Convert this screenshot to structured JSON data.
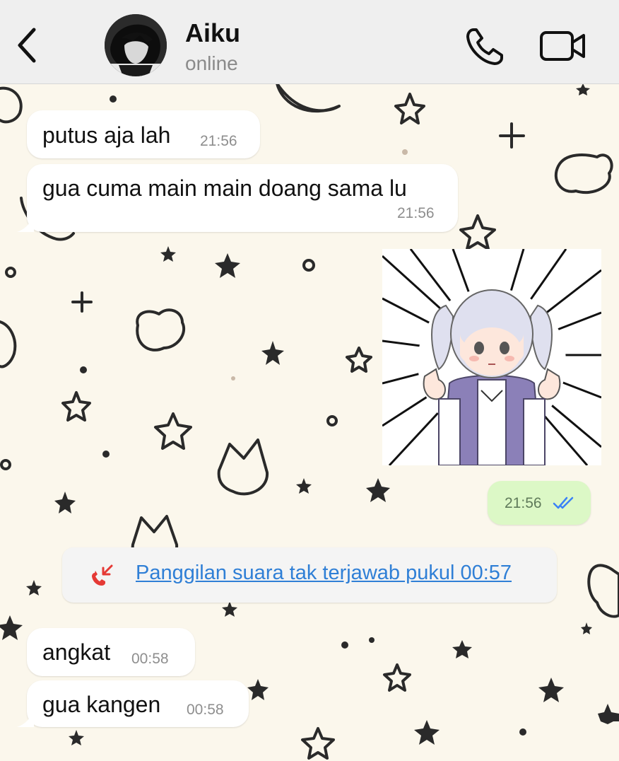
{
  "header": {
    "contact_name": "Aiku",
    "status": "online"
  },
  "messages": [
    {
      "text": "putus aja lah",
      "time": "21:56",
      "direction": "incoming"
    },
    {
      "text": "gua cuma main main doang sama lu",
      "time": "21:56",
      "direction": "incoming"
    },
    {
      "type": "sticker",
      "direction": "outgoing"
    },
    {
      "time": "21:56",
      "direction": "outgoing",
      "read": true
    },
    {
      "text": "angkat",
      "time": "00:58",
      "direction": "incoming"
    },
    {
      "text": "gua kangen",
      "time": "00:58",
      "direction": "incoming"
    }
  ],
  "missed_call": {
    "text": "Panggilan suara tak terjawab pukul 00:57"
  },
  "icons": {
    "back": "chevron-left-icon",
    "call": "phone-icon",
    "video": "video-camera-icon",
    "missed_call": "missed-call-icon",
    "read_receipt": "double-check-icon"
  },
  "colors": {
    "outgoing_bubble": "#dcf8c6",
    "incoming_bubble": "#ffffff",
    "link": "#2f7fd6",
    "missed_call_icon": "#e53935",
    "read_ticks": "#3b82f6",
    "wallpaper": "#fbf7ec"
  }
}
